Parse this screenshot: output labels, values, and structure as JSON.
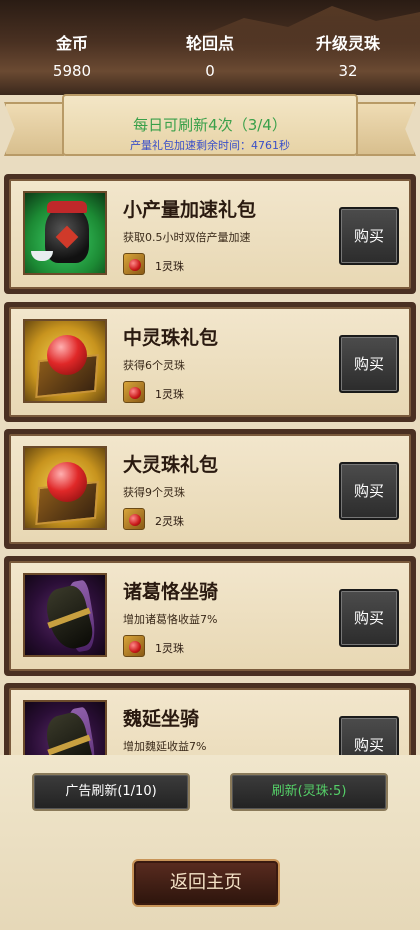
{
  "header": {
    "gold_label": "金币",
    "gold_value": "5980",
    "reincarnation_label": "轮回点",
    "reincarnation_value": "0",
    "upgrade_orb_label": "升级灵珠",
    "upgrade_orb_value": "32"
  },
  "banner": {
    "refresh_text": "每日可刷新4次（3/4）",
    "speedup_text": "产量礼包加速剩余时间：4761秒"
  },
  "items": [
    {
      "name": "小产量加速礼包",
      "desc": "获取0.5小时双倍产量加速",
      "cost": "1灵珠",
      "buy_label": "购买",
      "icon": "wine-jar-icon"
    },
    {
      "name": "中灵珠礼包",
      "desc": "获得6个灵珠",
      "cost": "1灵珠",
      "buy_label": "购买",
      "icon": "red-orb-icon"
    },
    {
      "name": "大灵珠礼包",
      "desc": "获得9个灵珠",
      "cost": "2灵珠",
      "buy_label": "购买",
      "icon": "red-orb-icon"
    },
    {
      "name": "诸葛恪坐骑",
      "desc": "增加诸葛恪收益7%",
      "cost": "1灵珠",
      "buy_label": "购买",
      "icon": "warhorse-icon"
    },
    {
      "name": "魏延坐骑",
      "desc": "增加魏延收益7%",
      "cost": "",
      "buy_label": "购买",
      "icon": "warhorse-icon"
    }
  ],
  "bottom": {
    "ad_refresh_label": "广告刷新(1/10)",
    "orb_refresh_label": "刷新(灵珠:5)",
    "home_label": "返回主页"
  },
  "colors": {
    "refresh_green": "#3aa04a",
    "speedup_blue": "#3a4fc8",
    "orb_refresh_green": "#55d068"
  }
}
